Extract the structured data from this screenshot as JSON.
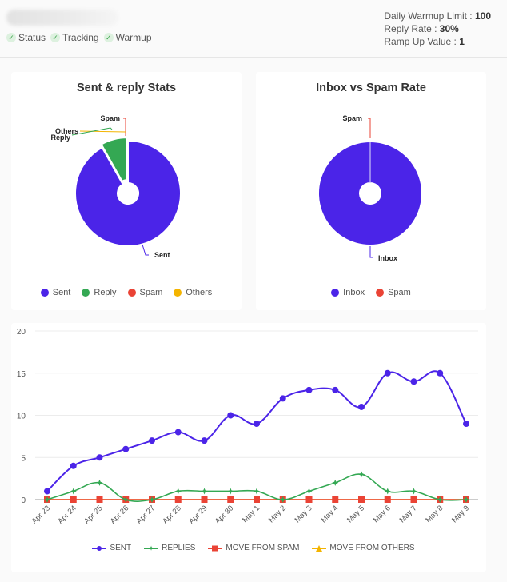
{
  "header": {
    "flags": [
      {
        "label": "Status",
        "icon": "check-icon"
      },
      {
        "label": "Tracking",
        "icon": "check-icon"
      },
      {
        "label": "Warmup",
        "icon": "check-icon"
      }
    ],
    "limits": [
      {
        "label": "Daily Warmup Limit : ",
        "value": "100"
      },
      {
        "label": "Reply Rate : ",
        "value": "30%"
      },
      {
        "label": "Ramp Up Value : ",
        "value": "1"
      }
    ]
  },
  "colors": {
    "sent": "#4b24e8",
    "reply": "#34a853",
    "spam": "#ea4335",
    "others": "#f4b400",
    "grid": "#ececec",
    "axis": "#999999"
  },
  "chart_data": [
    {
      "type": "pie",
      "title": "Sent & reply Stats",
      "labels": [
        "Sent",
        "Reply",
        "Spam",
        "Others"
      ],
      "values": [
        169,
        15,
        0,
        0
      ],
      "legend_position": "bottom",
      "donut": true
    },
    {
      "type": "pie",
      "title": "Inbox vs Spam Rate",
      "labels": [
        "Inbox",
        "Spam"
      ],
      "values": [
        100,
        0
      ],
      "legend_position": "bottom",
      "donut": true
    },
    {
      "type": "line",
      "title": "",
      "x": [
        "Apr 23",
        "Apr 24",
        "Apr 25",
        "Apr 26",
        "Apr 27",
        "Apr 28",
        "Apr 29",
        "Apr 30",
        "May 1",
        "May 2",
        "May 3",
        "May 4",
        "May 5",
        "May 6",
        "May 7",
        "May 8",
        "May 9"
      ],
      "series": [
        {
          "name": "SENT",
          "values": [
            1,
            4,
            5,
            6,
            7,
            8,
            7,
            10,
            9,
            12,
            13,
            13,
            11,
            15,
            14,
            15,
            9
          ]
        },
        {
          "name": "REPLIES",
          "values": [
            0,
            1,
            2,
            0,
            0,
            1,
            1,
            1,
            1,
            0,
            1,
            2,
            3,
            1,
            1,
            0,
            0
          ]
        },
        {
          "name": "MOVE FROM SPAM",
          "values": [
            0,
            0,
            0,
            0,
            0,
            0,
            0,
            0,
            0,
            0,
            0,
            0,
            0,
            0,
            0,
            0,
            0
          ]
        },
        {
          "name": "MOVE FROM OTHERS",
          "values": [
            0,
            0,
            0,
            0,
            0,
            0,
            0,
            0,
            0,
            0,
            0,
            0,
            0,
            0,
            0,
            0,
            0
          ]
        }
      ],
      "yticks": [
        0,
        5,
        10,
        15,
        20
      ],
      "ylim": [
        0,
        20
      ],
      "grid": true,
      "legend_position": "bottom",
      "smooth": true
    }
  ]
}
